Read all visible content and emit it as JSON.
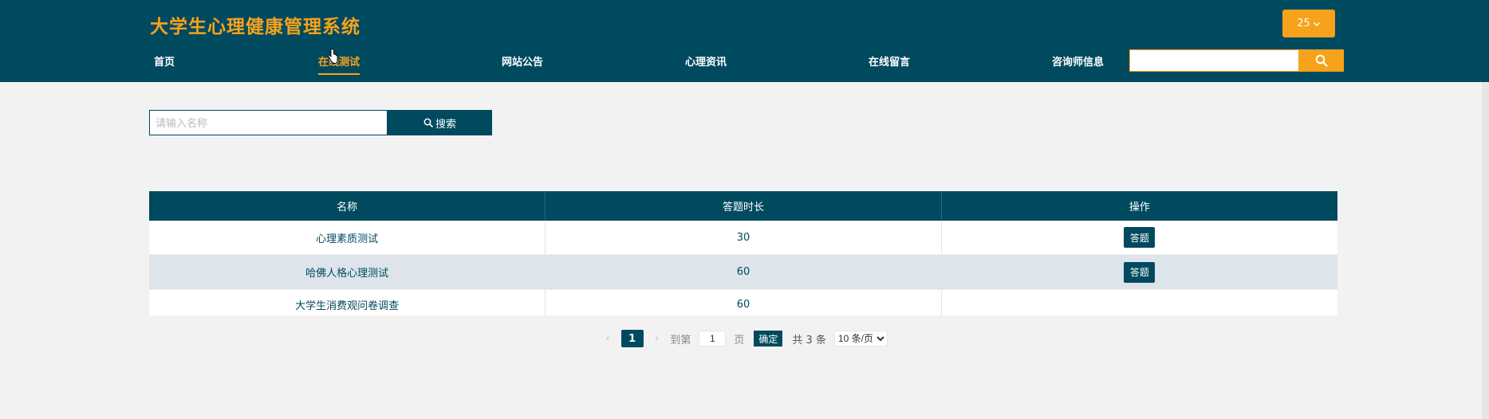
{
  "header": {
    "title": "大学生心理健康管理系统",
    "user_label": "25",
    "user_icon": "chevron-down-icon",
    "nav": [
      {
        "label": "首页"
      },
      {
        "label": "在线测试",
        "active": true
      },
      {
        "label": "网站公告"
      },
      {
        "label": "心理资讯"
      },
      {
        "label": "在线留言"
      },
      {
        "label": "咨询师信息"
      }
    ],
    "search_value": "",
    "search_icon": "search-icon"
  },
  "filter": {
    "placeholder": "请输入名称",
    "button_label": "搜索",
    "button_icon": "search-icon"
  },
  "table": {
    "columns": [
      "名称",
      "答题时长",
      "操作"
    ],
    "rows": [
      {
        "name": "心理素质测试",
        "duration": "30",
        "action": "答题"
      },
      {
        "name": "哈佛人格心理测试",
        "duration": "60",
        "action": "答题"
      },
      {
        "name": "大学生消费观问卷调查",
        "duration": "60",
        "action": ""
      }
    ]
  },
  "pagination": {
    "current_page": "1",
    "goto_label": "到第",
    "goto_value": "1",
    "page_unit": "页",
    "confirm_label": "确定",
    "total_label": "共 3 条",
    "page_size_option": "10 条/页"
  },
  "colors": {
    "primary": "#004a60",
    "accent": "#f7a21b",
    "background": "#f2f2f2"
  }
}
